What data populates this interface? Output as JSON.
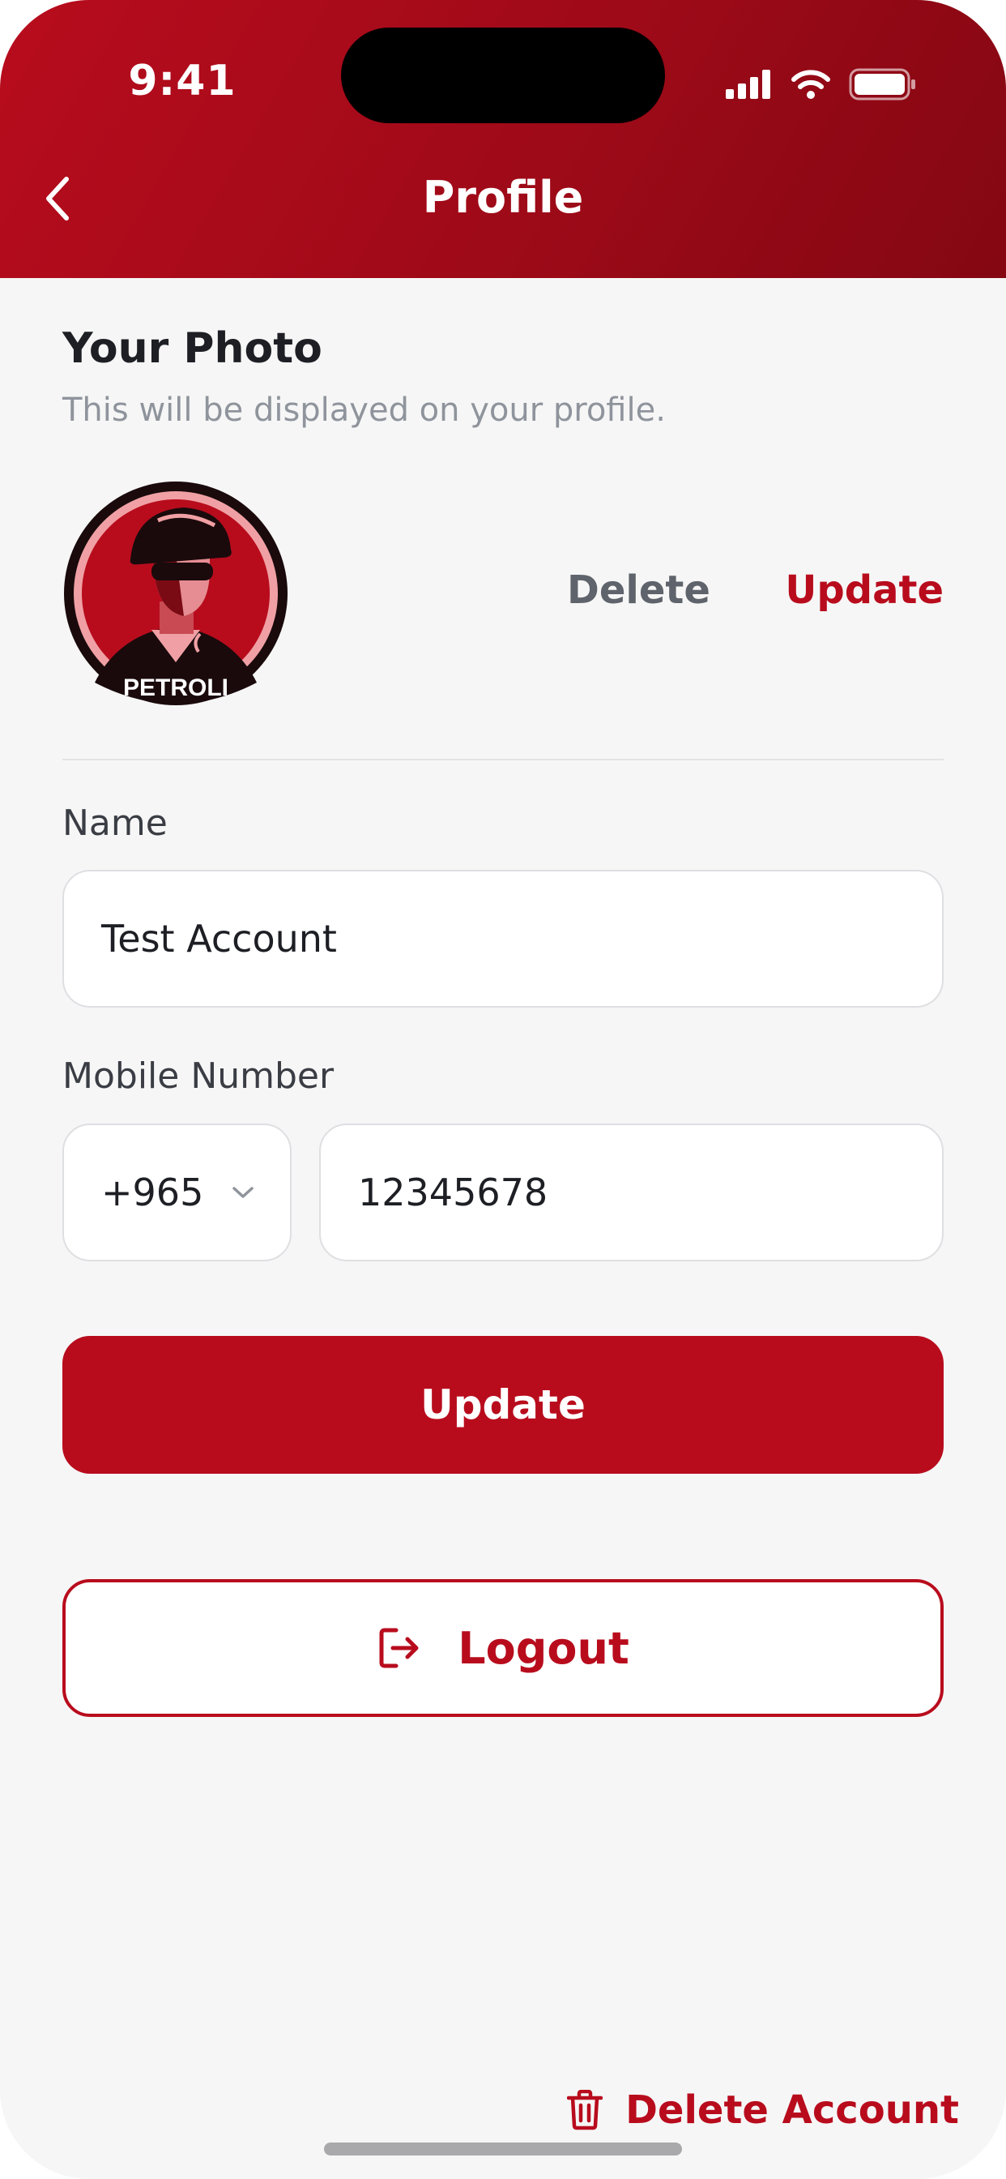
{
  "status_bar": {
    "time": "9:41"
  },
  "header": {
    "title": "Profile",
    "back_icon": "chevron-left-icon",
    "color_start": "#b80c1d",
    "color_end": "#840712"
  },
  "photo": {
    "title": "Your Photo",
    "subtitle": "This will be displayed on your profile.",
    "avatar_text": "PETROLI",
    "delete_label": "Delete",
    "update_label": "Update"
  },
  "form": {
    "name_label": "Name",
    "name_value": "Test Account",
    "mobile_label": "Mobile Number",
    "country_code": "+965",
    "phone_value": "12345678",
    "update_button": "Update"
  },
  "logout": {
    "label": "Logout",
    "icon": "logout-icon"
  },
  "delete_account": {
    "label": "Delete Account",
    "icon": "trash-icon"
  },
  "colors": {
    "brand": "#b80c1d",
    "background": "#f6f6f6"
  }
}
